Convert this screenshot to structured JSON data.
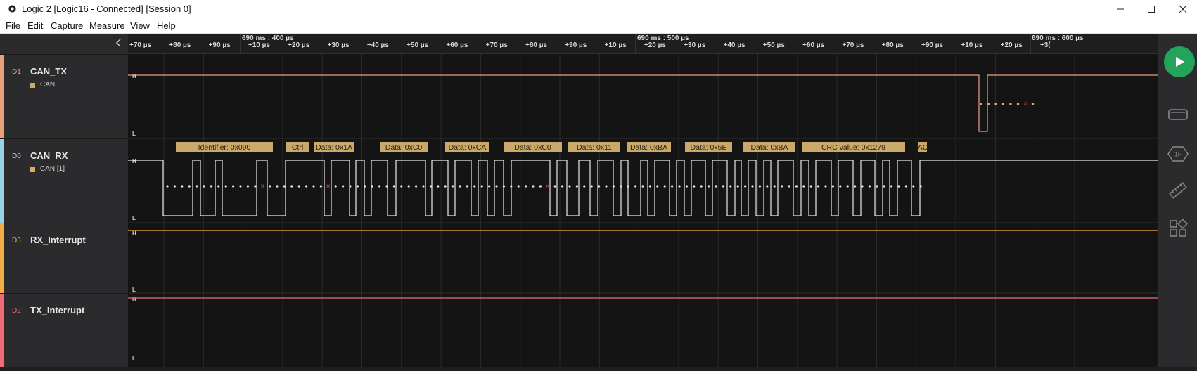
{
  "window": {
    "title": "Logic 2 [Logic16 - Connected] [Session 0]",
    "icon": "gear-icon"
  },
  "menu": {
    "items": [
      "File",
      "Edit",
      "Capture",
      "Measure",
      "View",
      "Help"
    ]
  },
  "timeline": {
    "major": [
      "690 ms : 400 µs",
      "690 ms : 500 µs",
      "690 ms : 600 µs"
    ],
    "ticks": [
      "+70 µs",
      "+80 µs",
      "+90 µs",
      "+10 µs",
      "+20 µs",
      "+30 µs",
      "+40 µs",
      "+50 µs",
      "+60 µs",
      "+70 µs",
      "+80 µs",
      "+90 µs",
      "+10 µs",
      "+20 µs",
      "+30 µs",
      "+40 µs",
      "+50 µs",
      "+60 µs",
      "+70 µs",
      "+80 µs",
      "+90 µs",
      "+10 µs",
      "+20 µs",
      "+3("
    ]
  },
  "channels": [
    {
      "index": "D1",
      "name": "CAN_TX",
      "analyzer": "CAN",
      "color": "#e8a07a",
      "has_analyzer": true
    },
    {
      "index": "D0",
      "name": "CAN_RX",
      "analyzer": "CAN [1]",
      "color": "#9ad0e8",
      "has_analyzer": true
    },
    {
      "index": "D3",
      "name": "RX_Interrupt",
      "analyzer": "",
      "color": "#f0b045",
      "has_analyzer": false
    },
    {
      "index": "D2",
      "name": "TX_Interrupt",
      "analyzer": "",
      "color": "#f06a7a",
      "has_analyzer": false
    }
  ],
  "level_labels": {
    "high": "H",
    "low": "L"
  },
  "decodes": [
    "Identifier: 0x090",
    "Ctrl",
    "Data: 0x1A",
    "Data: 0xC0",
    "Data: 0xCA",
    "Data: 0xC0",
    "Data: 0x11",
    "Data: 0xBA",
    "Data: 0x5E",
    "Data: 0xBA",
    "CRC value: 0x1279",
    "AC"
  ],
  "sidebar": {
    "run_icon": "play-icon",
    "icons": [
      "device-icon",
      "analyzer-icon",
      "measure-icon",
      "extensions-icon"
    ],
    "analyzer_icon_label": "1F"
  },
  "colors": {
    "accent_green": "#24a35a",
    "decode_fill": "#c9a86a",
    "wave_white": "#e8e8e8"
  }
}
